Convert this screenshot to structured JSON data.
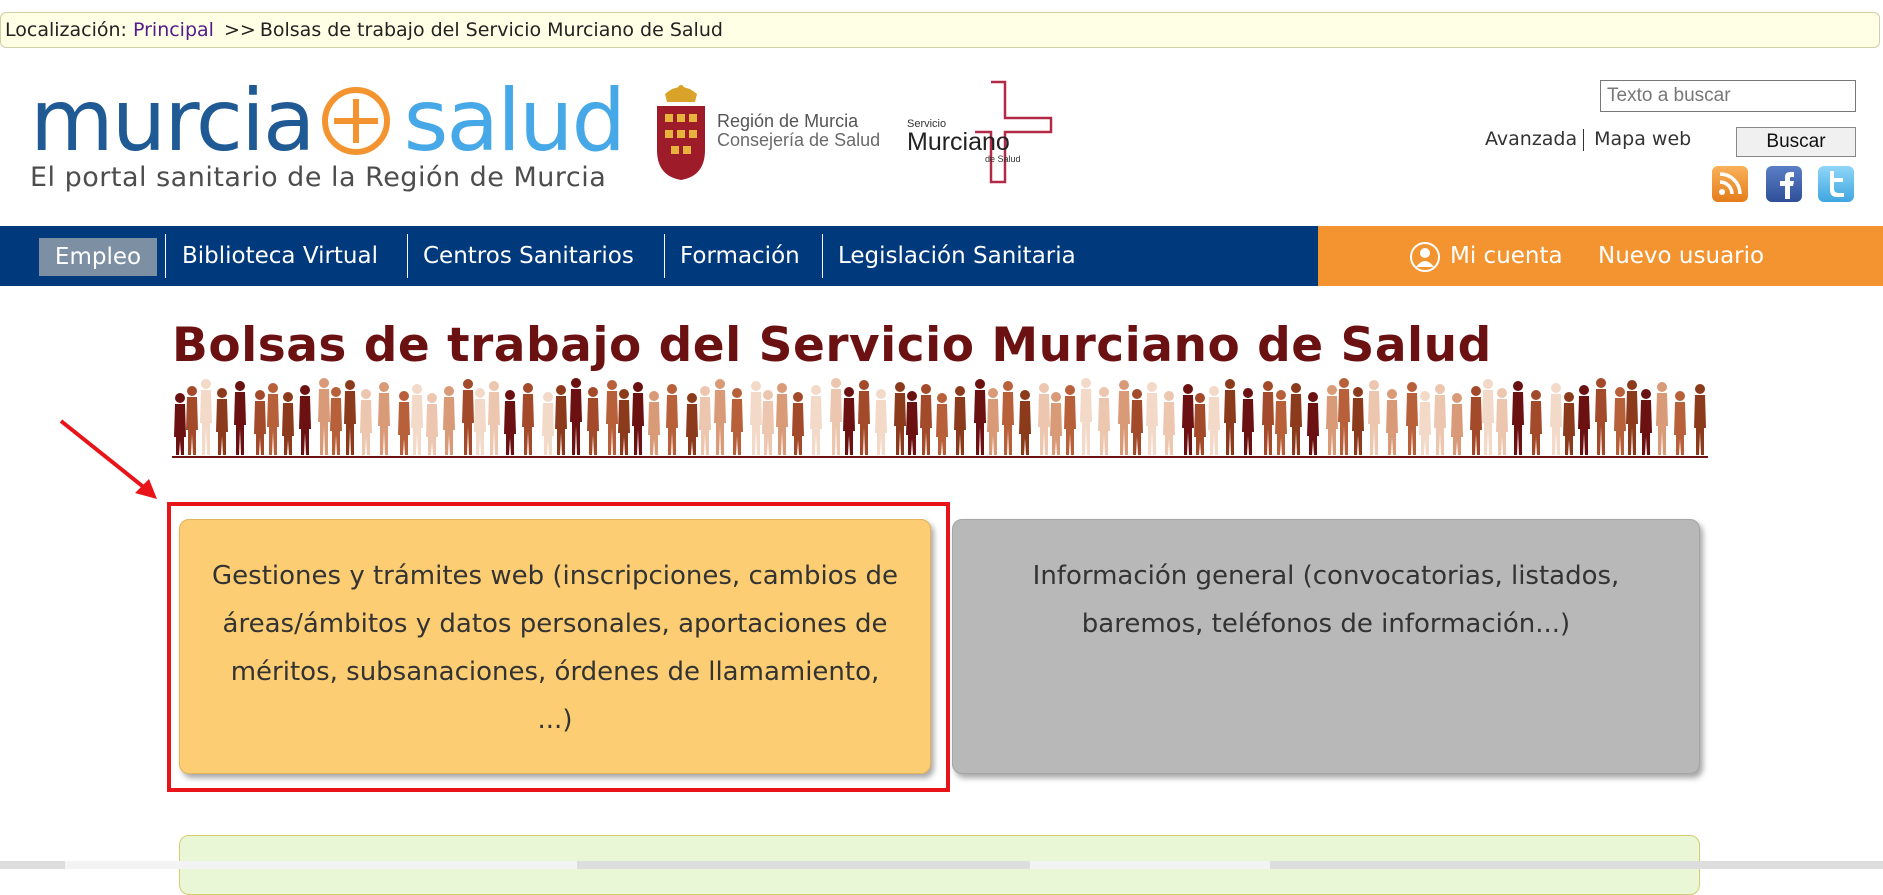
{
  "breadcrumb": {
    "label": "Localización:",
    "home": "Principal",
    "separator": ">>",
    "current": "Bolsas de trabajo del Servicio Murciano de Salud"
  },
  "logos": {
    "murcia_word1": "murcia",
    "murcia_word2": "salud",
    "murcia_tagline": "El portal sanitario de la Región de Murcia",
    "region_line1": "Región de Murcia",
    "region_line2": "Consejería de Salud",
    "sms_line1": "Servicio",
    "sms_line2": "Murciano",
    "sms_line3": "de Salud"
  },
  "search": {
    "placeholder": "Texto a buscar",
    "advanced": "Avanzada",
    "sitemap": "Mapa web",
    "button": "Buscar"
  },
  "social_icons": [
    "rss-icon",
    "facebook-icon",
    "twitter-icon"
  ],
  "nav": {
    "active": "Empleo",
    "items": [
      "Biblioteca Virtual",
      "Centros Sanitarios",
      "Formación",
      "Legislación Sanitaria"
    ],
    "account": "Mi cuenta",
    "new_user": "Nuevo usuario"
  },
  "page": {
    "title": "Bolsas de trabajo del Servicio Murciano de Salud"
  },
  "cards": {
    "gestiones": "Gestiones y trámites web (inscripciones, cambios de áreas/ámbitos y datos personales, aportaciones de méritos, subsanaciones, órdenes de llamamiento, ...)",
    "informacion": "Información general (convocatorias, listados, baremos, teléfonos de información...)"
  },
  "colors": {
    "nav_blue": "#003a7d",
    "nav_orange": "#f39431",
    "title_maroon": "#6b1111",
    "card_orange": "#fccd72",
    "card_grey": "#b8b8b8",
    "highlight_red": "#e8141a"
  }
}
